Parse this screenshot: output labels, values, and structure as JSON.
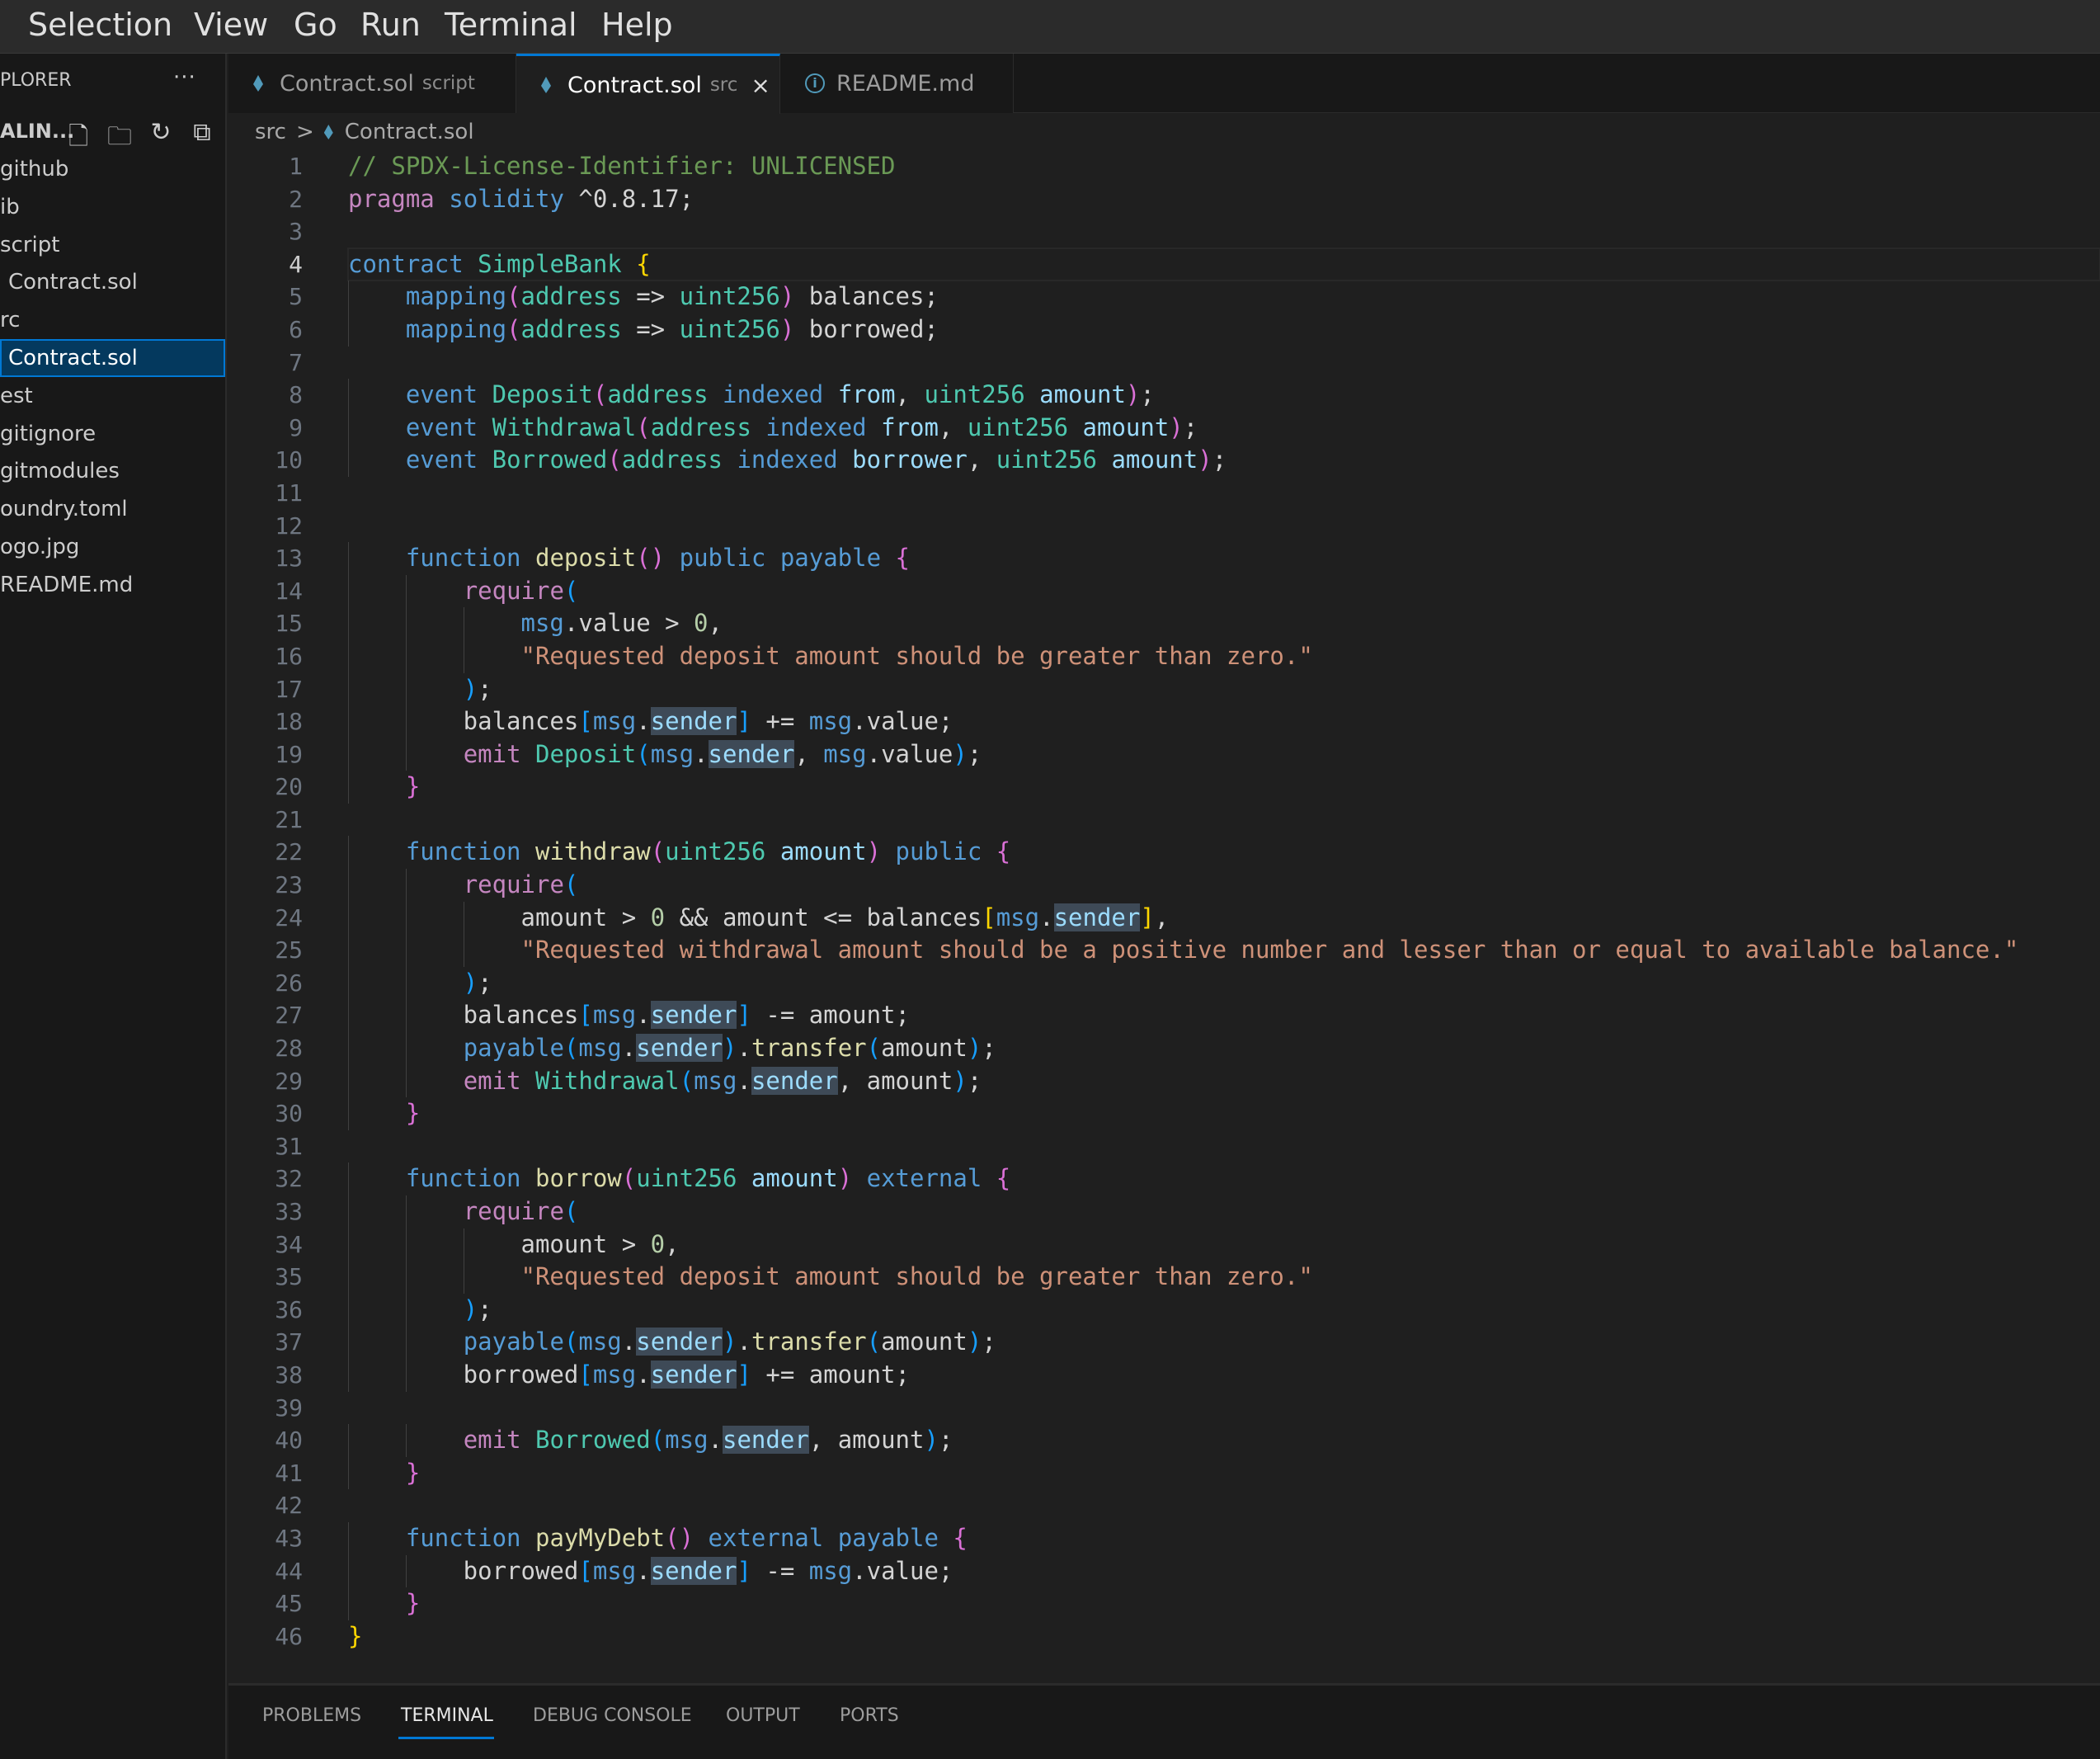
{
  "menu": [
    "Selection",
    "View",
    "Go",
    "Run",
    "Terminal",
    "Help"
  ],
  "sidebar": {
    "title": "PLORER",
    "more_icon": "ellipsis-icon",
    "workspace": "ALIN...",
    "toolbar_icons": [
      "new-file-icon",
      "new-folder-icon",
      "refresh-icon",
      "collapse-all-icon"
    ],
    "items": [
      {
        "label": "github",
        "indent": 0
      },
      {
        "label": "ib",
        "indent": 0
      },
      {
        "label": "script",
        "indent": 0
      },
      {
        "label": "Contract.sol",
        "indent": 1
      },
      {
        "label": "rc",
        "indent": 0
      },
      {
        "label": "Contract.sol",
        "indent": 1,
        "selected": true
      },
      {
        "label": "est",
        "indent": 0
      },
      {
        "label": "gitignore",
        "indent": 0
      },
      {
        "label": "gitmodules",
        "indent": 0
      },
      {
        "label": "oundry.toml",
        "indent": 0
      },
      {
        "label": "ogo.jpg",
        "indent": 0
      },
      {
        "label": "README.md",
        "indent": 0
      }
    ]
  },
  "tabs": [
    {
      "label": "Contract.sol",
      "desc": "script",
      "icon": "ethereum-icon"
    },
    {
      "label": "Contract.sol",
      "desc": "src",
      "icon": "ethereum-icon",
      "active": true,
      "close": "×"
    },
    {
      "label": "README.md",
      "desc": "",
      "icon": "info-icon",
      "info_glyph": "i"
    }
  ],
  "breadcrumb": {
    "folder": "src",
    "sep": ">",
    "file": "Contract.sol"
  },
  "editor": {
    "current_line": 4,
    "lines": [
      [
        [
          "c",
          "// SPDX-License-Identifier: UNLICENSED"
        ]
      ],
      [
        [
          "p",
          "pragma"
        ],
        [
          "",
          " "
        ],
        [
          "k",
          "solidity"
        ],
        [
          "",
          " ^0.8.17;"
        ]
      ],
      [],
      [
        [
          "k",
          "contract"
        ],
        [
          "",
          " "
        ],
        [
          "t",
          "SimpleBank"
        ],
        [
          "",
          " "
        ],
        [
          "b1",
          "{"
        ]
      ],
      [
        [
          "",
          "    "
        ],
        [
          "k",
          "mapping"
        ],
        [
          "b2",
          "("
        ],
        [
          "t",
          "address"
        ],
        [
          "",
          " => "
        ],
        [
          "t",
          "uint256"
        ],
        [
          "b2",
          ")"
        ],
        [
          "",
          " balances;"
        ]
      ],
      [
        [
          "",
          "    "
        ],
        [
          "k",
          "mapping"
        ],
        [
          "b2",
          "("
        ],
        [
          "t",
          "address"
        ],
        [
          "",
          " => "
        ],
        [
          "t",
          "uint256"
        ],
        [
          "b2",
          ")"
        ],
        [
          "",
          " borrowed;"
        ]
      ],
      [],
      [
        [
          "",
          "    "
        ],
        [
          "k",
          "event"
        ],
        [
          "",
          " "
        ],
        [
          "t",
          "Deposit"
        ],
        [
          "b2",
          "("
        ],
        [
          "t",
          "address"
        ],
        [
          "",
          " "
        ],
        [
          "k",
          "indexed"
        ],
        [
          "",
          " "
        ],
        [
          "v",
          "from"
        ],
        [
          "",
          ", "
        ],
        [
          "t",
          "uint256"
        ],
        [
          "",
          " "
        ],
        [
          "v",
          "amount"
        ],
        [
          "b2",
          ")"
        ],
        [
          "",
          ";"
        ]
      ],
      [
        [
          "",
          "    "
        ],
        [
          "k",
          "event"
        ],
        [
          "",
          " "
        ],
        [
          "t",
          "Withdrawal"
        ],
        [
          "b2",
          "("
        ],
        [
          "t",
          "address"
        ],
        [
          "",
          " "
        ],
        [
          "k",
          "indexed"
        ],
        [
          "",
          " "
        ],
        [
          "v",
          "from"
        ],
        [
          "",
          ", "
        ],
        [
          "t",
          "uint256"
        ],
        [
          "",
          " "
        ],
        [
          "v",
          "amount"
        ],
        [
          "b2",
          ")"
        ],
        [
          "",
          ";"
        ]
      ],
      [
        [
          "",
          "    "
        ],
        [
          "k",
          "event"
        ],
        [
          "",
          " "
        ],
        [
          "t",
          "Borrowed"
        ],
        [
          "b2",
          "("
        ],
        [
          "t",
          "address"
        ],
        [
          "",
          " "
        ],
        [
          "k",
          "indexed"
        ],
        [
          "",
          " "
        ],
        [
          "v",
          "borrower"
        ],
        [
          "",
          ", "
        ],
        [
          "t",
          "uint256"
        ],
        [
          "",
          " "
        ],
        [
          "v",
          "amount"
        ],
        [
          "b2",
          ")"
        ],
        [
          "",
          ";"
        ]
      ],
      [],
      [],
      [
        [
          "",
          "    "
        ],
        [
          "k",
          "function"
        ],
        [
          "",
          " "
        ],
        [
          "f",
          "deposit"
        ],
        [
          "b2",
          "()"
        ],
        [
          "",
          " "
        ],
        [
          "k",
          "public"
        ],
        [
          "",
          " "
        ],
        [
          "k",
          "payable"
        ],
        [
          "",
          " "
        ],
        [
          "b2",
          "{"
        ]
      ],
      [
        [
          "",
          "        "
        ],
        [
          "p",
          "require"
        ],
        [
          "b3",
          "("
        ]
      ],
      [
        [
          "",
          "            "
        ],
        [
          "k",
          "msg"
        ],
        [
          "",
          ".value > "
        ],
        [
          "n",
          "0"
        ],
        [
          "",
          ","
        ]
      ],
      [
        [
          "",
          "            "
        ],
        [
          "s",
          "\"Requested deposit amount should be greater than zero.\""
        ]
      ],
      [
        [
          "",
          "        "
        ],
        [
          "b3",
          ")"
        ],
        [
          "",
          ";"
        ]
      ],
      [
        [
          "",
          "        balances"
        ],
        [
          "b3",
          "["
        ],
        [
          "k",
          "msg"
        ],
        [
          "",
          "."
        ],
        [
          "h",
          "sender"
        ],
        [
          "b3",
          "]"
        ],
        [
          "",
          " += "
        ],
        [
          "k",
          "msg"
        ],
        [
          "",
          ".value;"
        ]
      ],
      [
        [
          "",
          "        "
        ],
        [
          "p",
          "emit"
        ],
        [
          "",
          " "
        ],
        [
          "t",
          "Deposit"
        ],
        [
          "b3",
          "("
        ],
        [
          "k",
          "msg"
        ],
        [
          "",
          "."
        ],
        [
          "h",
          "sender"
        ],
        [
          "",
          ", "
        ],
        [
          "k",
          "msg"
        ],
        [
          "",
          ".value"
        ],
        [
          "b3",
          ")"
        ],
        [
          "",
          ";"
        ]
      ],
      [
        [
          "",
          "    "
        ],
        [
          "b2",
          "}"
        ]
      ],
      [],
      [
        [
          "",
          "    "
        ],
        [
          "k",
          "function"
        ],
        [
          "",
          " "
        ],
        [
          "f",
          "withdraw"
        ],
        [
          "b2",
          "("
        ],
        [
          "t",
          "uint256"
        ],
        [
          "",
          " "
        ],
        [
          "v",
          "amount"
        ],
        [
          "b2",
          ")"
        ],
        [
          "",
          " "
        ],
        [
          "k",
          "public"
        ],
        [
          "",
          " "
        ],
        [
          "b2",
          "{"
        ]
      ],
      [
        [
          "",
          "        "
        ],
        [
          "p",
          "require"
        ],
        [
          "b3",
          "("
        ]
      ],
      [
        [
          "",
          "            amount > "
        ],
        [
          "n",
          "0"
        ],
        [
          "",
          " && amount <= balances"
        ],
        [
          "b1",
          "["
        ],
        [
          "k",
          "msg"
        ],
        [
          "",
          "."
        ],
        [
          "h",
          "sender"
        ],
        [
          "b1",
          "]"
        ],
        [
          "",
          ","
        ]
      ],
      [
        [
          "",
          "            "
        ],
        [
          "s",
          "\"Requested withdrawal amount should be a positive number and lesser than or equal to available balance.\""
        ]
      ],
      [
        [
          "",
          "        "
        ],
        [
          "b3",
          ")"
        ],
        [
          "",
          ";"
        ]
      ],
      [
        [
          "",
          "        balances"
        ],
        [
          "b3",
          "["
        ],
        [
          "k",
          "msg"
        ],
        [
          "",
          "."
        ],
        [
          "h",
          "sender"
        ],
        [
          "b3",
          "]"
        ],
        [
          "",
          " -= amount;"
        ]
      ],
      [
        [
          "",
          "        "
        ],
        [
          "k",
          "payable"
        ],
        [
          "b3",
          "("
        ],
        [
          "k",
          "msg"
        ],
        [
          "",
          "."
        ],
        [
          "h",
          "sender"
        ],
        [
          "b3",
          ")"
        ],
        [
          "",
          "."
        ],
        [
          "f",
          "transfer"
        ],
        [
          "b3",
          "("
        ],
        [
          "",
          "amount"
        ],
        [
          "b3",
          ")"
        ],
        [
          "",
          ";"
        ]
      ],
      [
        [
          "",
          "        "
        ],
        [
          "p",
          "emit"
        ],
        [
          "",
          " "
        ],
        [
          "t",
          "Withdrawal"
        ],
        [
          "b3",
          "("
        ],
        [
          "k",
          "msg"
        ],
        [
          "",
          "."
        ],
        [
          "h",
          "sender"
        ],
        [
          "",
          ", amount"
        ],
        [
          "b3",
          ")"
        ],
        [
          "",
          ";"
        ]
      ],
      [
        [
          "",
          "    "
        ],
        [
          "b2",
          "}"
        ]
      ],
      [],
      [
        [
          "",
          "    "
        ],
        [
          "k",
          "function"
        ],
        [
          "",
          " "
        ],
        [
          "f",
          "borrow"
        ],
        [
          "b2",
          "("
        ],
        [
          "t",
          "uint256"
        ],
        [
          "",
          " "
        ],
        [
          "v",
          "amount"
        ],
        [
          "b2",
          ")"
        ],
        [
          "",
          " "
        ],
        [
          "k",
          "external"
        ],
        [
          "",
          " "
        ],
        [
          "b2",
          "{"
        ]
      ],
      [
        [
          "",
          "        "
        ],
        [
          "p",
          "require"
        ],
        [
          "b3",
          "("
        ]
      ],
      [
        [
          "",
          "            amount > "
        ],
        [
          "n",
          "0"
        ],
        [
          "",
          ","
        ]
      ],
      [
        [
          "",
          "            "
        ],
        [
          "s",
          "\"Requested deposit amount should be greater than zero.\""
        ]
      ],
      [
        [
          "",
          "        "
        ],
        [
          "b3",
          ")"
        ],
        [
          "",
          ";"
        ]
      ],
      [
        [
          "",
          "        "
        ],
        [
          "k",
          "payable"
        ],
        [
          "b3",
          "("
        ],
        [
          "k",
          "msg"
        ],
        [
          "",
          "."
        ],
        [
          "h",
          "sender"
        ],
        [
          "b3",
          ")"
        ],
        [
          "",
          "."
        ],
        [
          "f",
          "transfer"
        ],
        [
          "b3",
          "("
        ],
        [
          "",
          "amount"
        ],
        [
          "b3",
          ")"
        ],
        [
          "",
          ";"
        ]
      ],
      [
        [
          "",
          "        borrowed"
        ],
        [
          "b3",
          "["
        ],
        [
          "k",
          "msg"
        ],
        [
          "",
          "."
        ],
        [
          "h",
          "sender"
        ],
        [
          "b3",
          "]"
        ],
        [
          "",
          " += amount;"
        ]
      ],
      [],
      [
        [
          "",
          "        "
        ],
        [
          "p",
          "emit"
        ],
        [
          "",
          " "
        ],
        [
          "t",
          "Borrowed"
        ],
        [
          "b3",
          "("
        ],
        [
          "k",
          "msg"
        ],
        [
          "",
          "."
        ],
        [
          "h",
          "sender"
        ],
        [
          "",
          ", amount"
        ],
        [
          "b3",
          ")"
        ],
        [
          "",
          ";"
        ]
      ],
      [
        [
          "",
          "    "
        ],
        [
          "b2",
          "}"
        ]
      ],
      [],
      [
        [
          "",
          "    "
        ],
        [
          "k",
          "function"
        ],
        [
          "",
          " "
        ],
        [
          "f",
          "payMyDebt"
        ],
        [
          "b2",
          "()"
        ],
        [
          "",
          " "
        ],
        [
          "k",
          "external"
        ],
        [
          "",
          " "
        ],
        [
          "k",
          "payable"
        ],
        [
          "",
          " "
        ],
        [
          "b2",
          "{"
        ]
      ],
      [
        [
          "",
          "        borrowed"
        ],
        [
          "b3",
          "["
        ],
        [
          "k",
          "msg"
        ],
        [
          "",
          "."
        ],
        [
          "h",
          "sender"
        ],
        [
          "b3",
          "]"
        ],
        [
          "",
          " -= "
        ],
        [
          "k",
          "msg"
        ],
        [
          "",
          ".value;"
        ]
      ],
      [
        [
          "",
          "    "
        ],
        [
          "b2",
          "}"
        ]
      ],
      [
        [
          "b1",
          "}"
        ]
      ]
    ]
  },
  "panel": {
    "tabs": [
      "PROBLEMS",
      "TERMINAL",
      "DEBUG CONSOLE",
      "OUTPUT",
      "PORTS"
    ],
    "active": "TERMINAL"
  },
  "colors": {
    "accent": "#0078d4",
    "selection": "#04395e",
    "keyword": "#569cd6",
    "type": "#4ec9b0",
    "function": "#dcdcaa",
    "string": "#ce9178",
    "comment": "#6a9955"
  }
}
